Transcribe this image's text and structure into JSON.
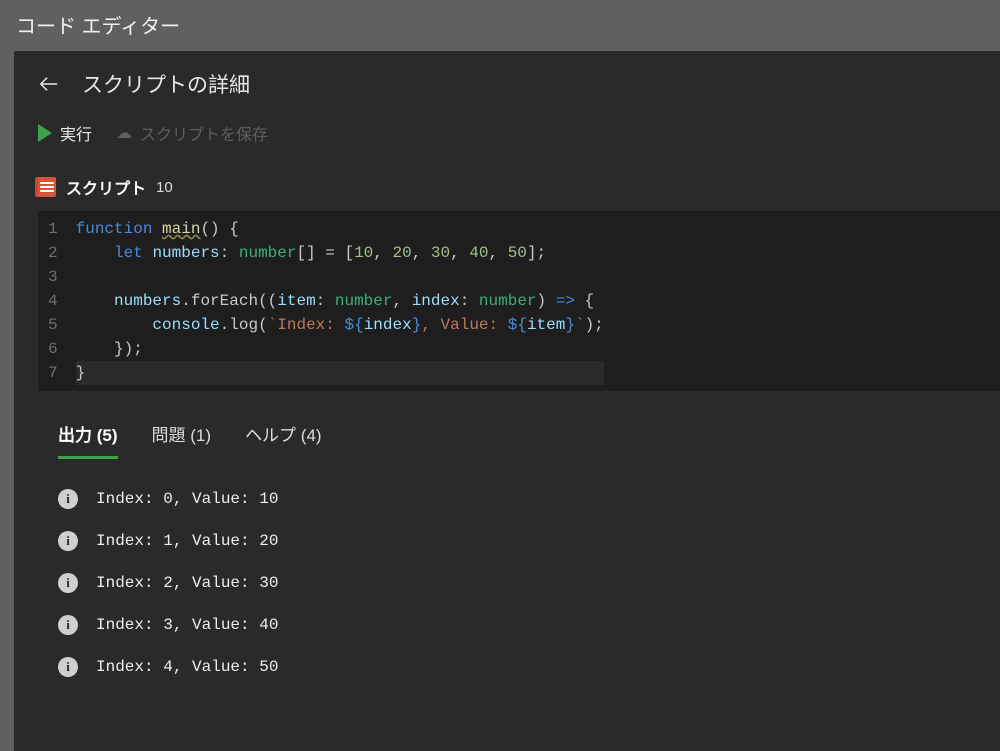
{
  "top_title": "コード エディター",
  "details_title": "スクリプトの詳細",
  "actions": {
    "run": "実行",
    "save": "スクリプトを保存"
  },
  "script": {
    "label": "スクリプト",
    "number": "10"
  },
  "code": {
    "lines": [
      1,
      2,
      3,
      4,
      5,
      6,
      7
    ],
    "source": "function main() {\n    let numbers: number[] = [10, 20, 30, 40, 50];\n\n    numbers.forEach((item: number, index: number) => {\n        console.log(`Index: ${index}, Value: ${item}`);\n    });\n}"
  },
  "tabs": {
    "output": {
      "label": "出力",
      "count": 5
    },
    "problems": {
      "label": "問題",
      "count": 1
    },
    "help": {
      "label": "ヘルプ",
      "count": 4
    }
  },
  "output": [
    "Index: 0, Value: 10",
    "Index: 1, Value: 20",
    "Index: 2, Value: 30",
    "Index: 3, Value: 40",
    "Index: 4, Value: 50"
  ]
}
